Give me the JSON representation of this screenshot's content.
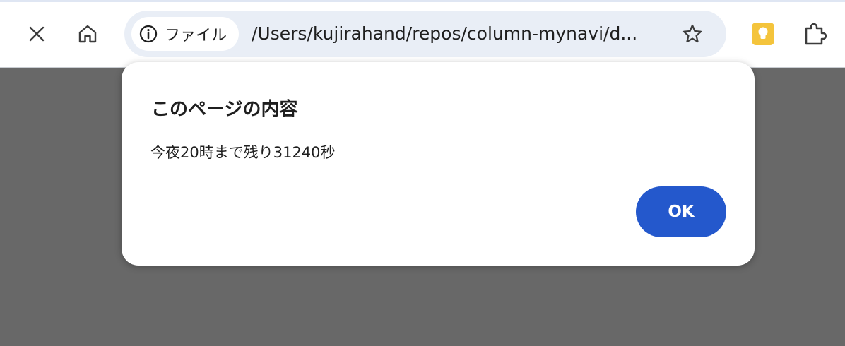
{
  "browser": {
    "site_info_label": "ファイル",
    "url": "/Users/kujirahand/repos/column-mynavi/d...",
    "extension_icon_color": "#f4c43c"
  },
  "dialog": {
    "title": "このページの内容",
    "message": "今夜20時まで残り31240秒",
    "ok_label": "OK",
    "ok_color": "#2458cc"
  },
  "icons": [
    "close-icon",
    "home-icon",
    "info-icon",
    "star-icon",
    "extension-app-icon",
    "puzzle-extensions-icon"
  ]
}
